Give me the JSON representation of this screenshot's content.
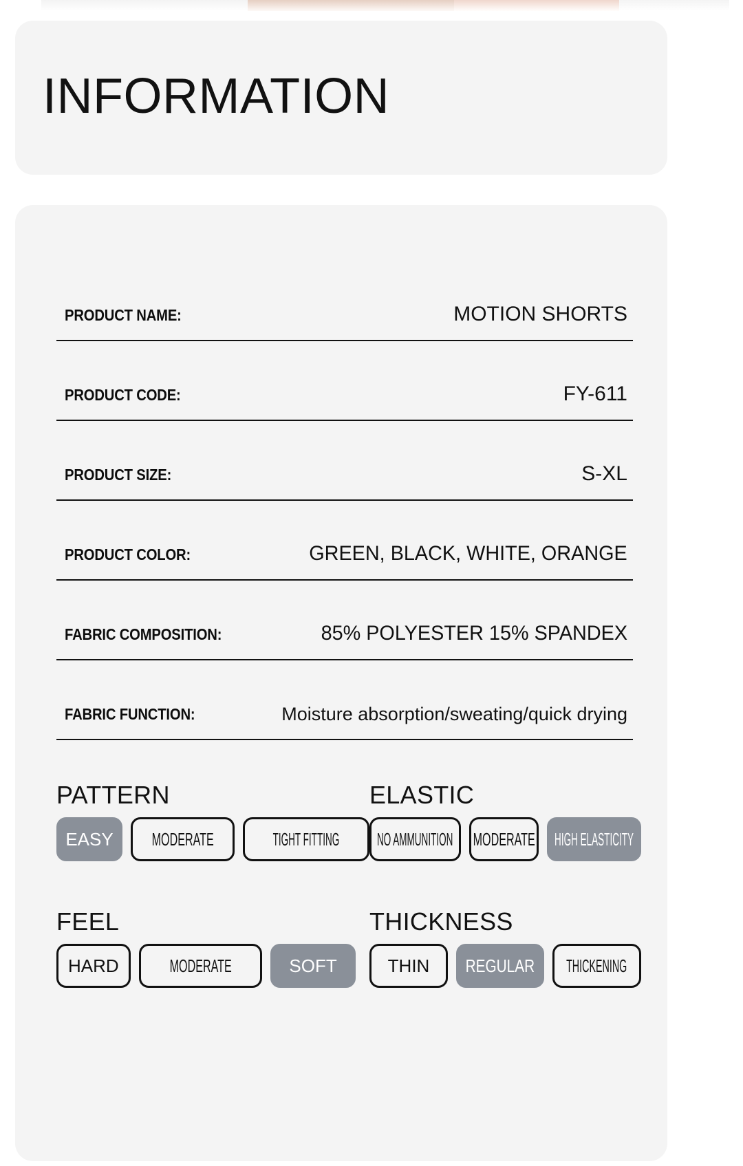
{
  "header": {
    "title": "INFORMATION"
  },
  "spec_table": {
    "rows": [
      {
        "label": "PRODUCT NAME:",
        "value": "MOTION SHORTS"
      },
      {
        "label": "PRODUCT CODE:",
        "value": "FY-611"
      },
      {
        "label": "PRODUCT SIZE:",
        "value": "S-XL"
      },
      {
        "label": "PRODUCT COLOR:",
        "value": "GREEN, BLACK, WHITE, ORANGE"
      },
      {
        "label": "FABRIC COMPOSITION:",
        "value": "85% POLYESTER 15% SPANDEX"
      },
      {
        "label": "FABRIC FUNCTION:",
        "value": "Moisture absorption/sweating/quick drying"
      }
    ]
  },
  "attributes": {
    "accent_selected_bg": "#8a9099",
    "accent_selected_text": "#ffffff",
    "card_bg": "#f4f4f4",
    "outline_color": "#111111",
    "groups": [
      {
        "title": "PATTERN",
        "options": [
          {
            "label": "EASY",
            "selected": true
          },
          {
            "label": "MODERATE",
            "selected": false
          },
          {
            "label": "TIGHT FITTING",
            "selected": false
          }
        ]
      },
      {
        "title": "ELASTIC",
        "options": [
          {
            "label": "NO AMMUNITION",
            "selected": false
          },
          {
            "label": "MODERATE",
            "selected": false
          },
          {
            "label": "HIGH ELASTICITY",
            "selected": true
          }
        ]
      },
      {
        "title": "FEEL",
        "options": [
          {
            "label": "HARD",
            "selected": false
          },
          {
            "label": "MODERATE",
            "selected": false
          },
          {
            "label": "SOFT",
            "selected": true
          }
        ]
      },
      {
        "title": "THICKNESS",
        "options": [
          {
            "label": "THIN",
            "selected": false
          },
          {
            "label": "REGULAR",
            "selected": true
          },
          {
            "label": "THICKENING",
            "selected": false
          }
        ]
      }
    ]
  }
}
